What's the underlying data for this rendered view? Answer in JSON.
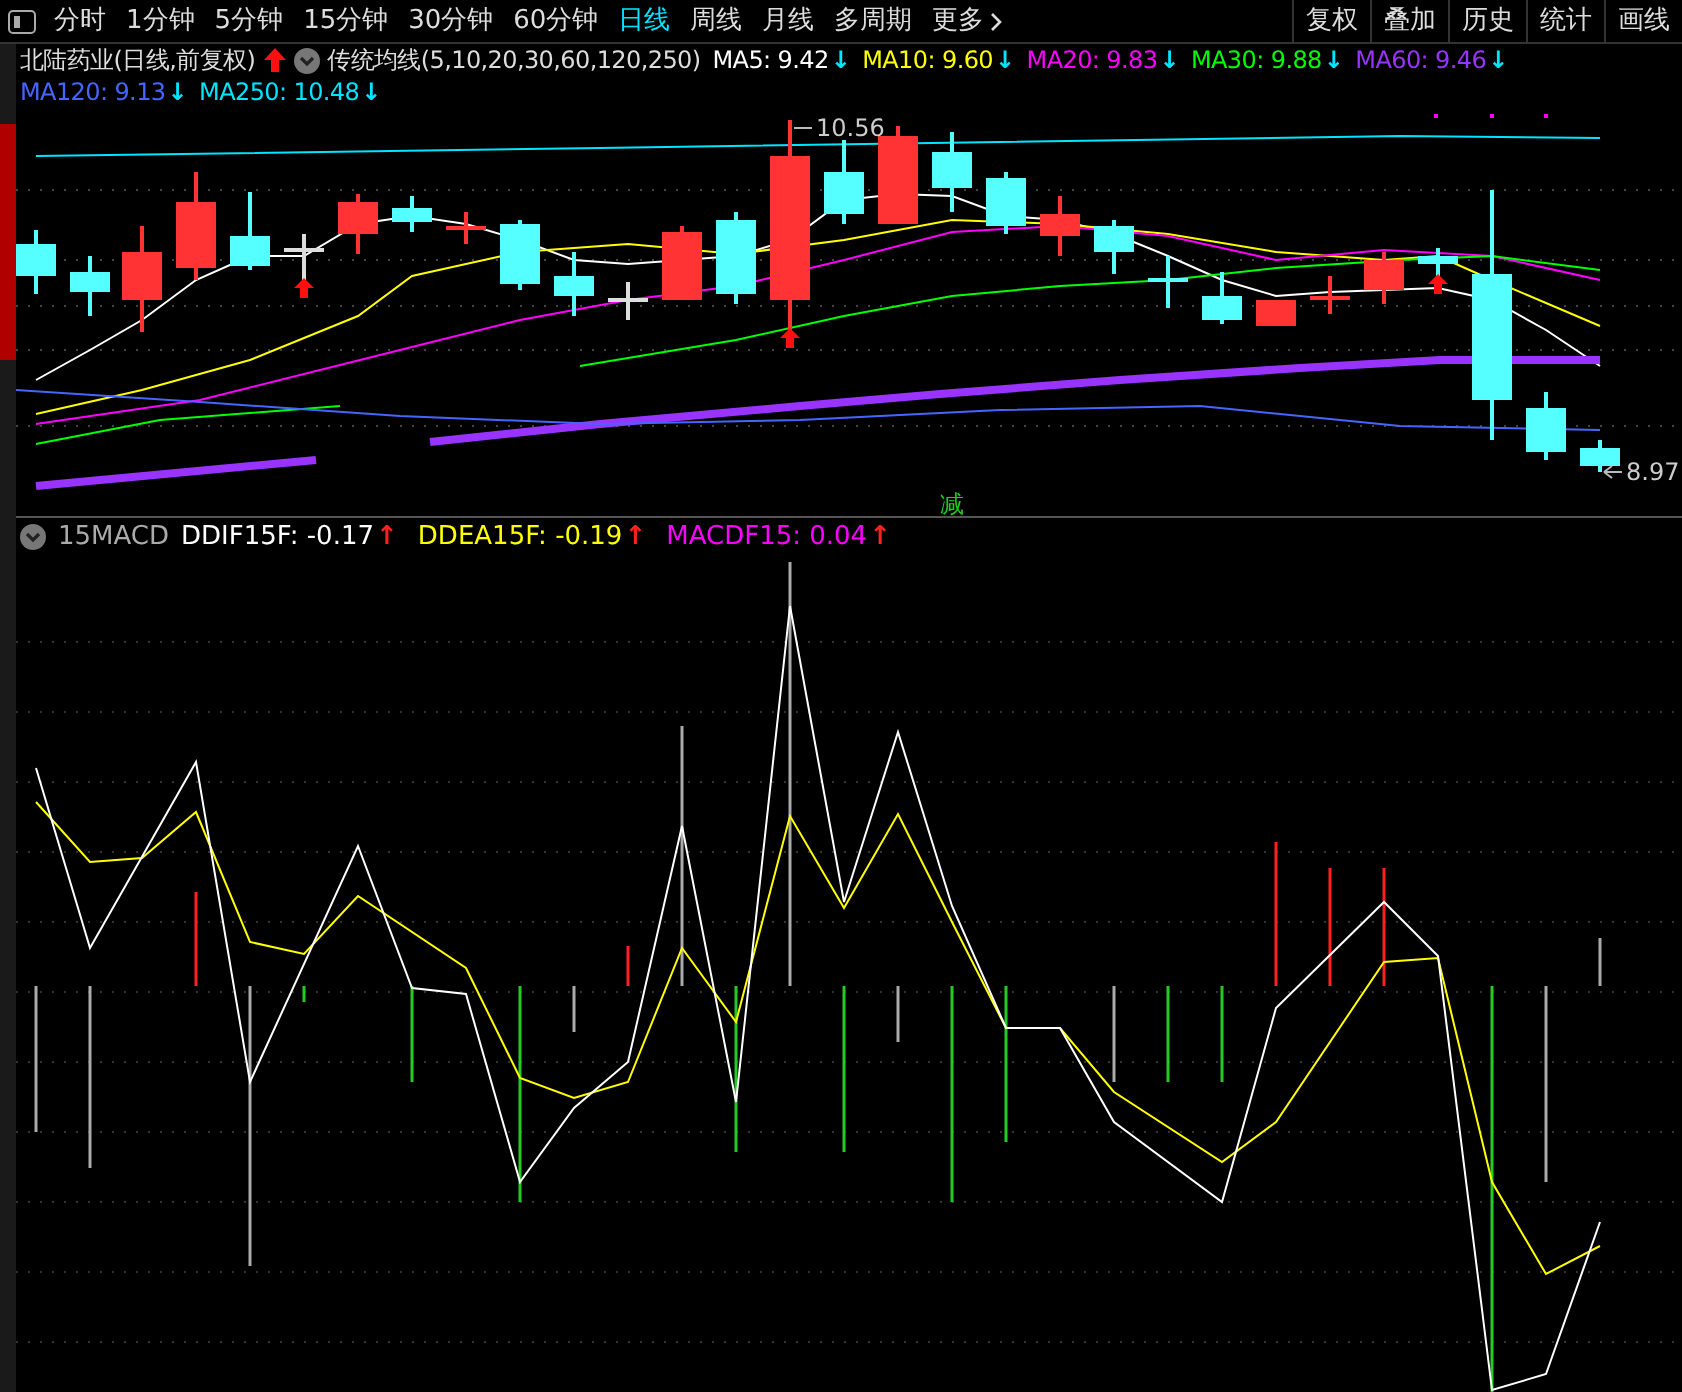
{
  "toolbar": {
    "periods": [
      {
        "label": "分时",
        "selected": false
      },
      {
        "label": "1分钟",
        "selected": false
      },
      {
        "label": "5分钟",
        "selected": false
      },
      {
        "label": "15分钟",
        "selected": false
      },
      {
        "label": "30分钟",
        "selected": false
      },
      {
        "label": "60分钟",
        "selected": false
      },
      {
        "label": "日线",
        "selected": true
      },
      {
        "label": "周线",
        "selected": false
      },
      {
        "label": "月线",
        "selected": false
      },
      {
        "label": "多周期",
        "selected": false
      }
    ],
    "more": "更多",
    "right_buttons": [
      "复权",
      "叠加",
      "历史",
      "统计",
      "画线"
    ]
  },
  "main_chart": {
    "title": "北陆药业(日线,前复权)",
    "indicator": "传统均线(5,10,20,30,60,120,250)",
    "ma": [
      {
        "label": "MA5: 9.42",
        "color": "#ffffff",
        "arrow": "↓"
      },
      {
        "label": "MA10: 9.60",
        "color": "#ffff00",
        "arrow": "↓"
      },
      {
        "label": "MA20: 9.83",
        "color": "#ff00ff",
        "arrow": "↓"
      },
      {
        "label": "MA30: 9.88",
        "color": "#00ff00",
        "arrow": "↓"
      },
      {
        "label": "MA60: 9.46",
        "color": "#9933ff",
        "arrow": "↓"
      },
      {
        "label": "MA120: 9.13",
        "color": "#4466ff",
        "arrow": "↓"
      },
      {
        "label": "MA250: 10.48",
        "color": "#00e5ff",
        "arrow": "↓"
      }
    ],
    "high_label": "10.56",
    "low_label": "8.97",
    "marker": "减"
  },
  "macd": {
    "title": "15MACD",
    "values": [
      {
        "label": "DDIF15F: -0.17",
        "color": "#ffffff",
        "arrow": "↑"
      },
      {
        "label": "DDEA15F: -0.19",
        "color": "#ffff00",
        "arrow": "↑"
      },
      {
        "label": "MACDF15: 0.04",
        "color": "#ff00ff",
        "arrow": "↑"
      }
    ]
  }
}
